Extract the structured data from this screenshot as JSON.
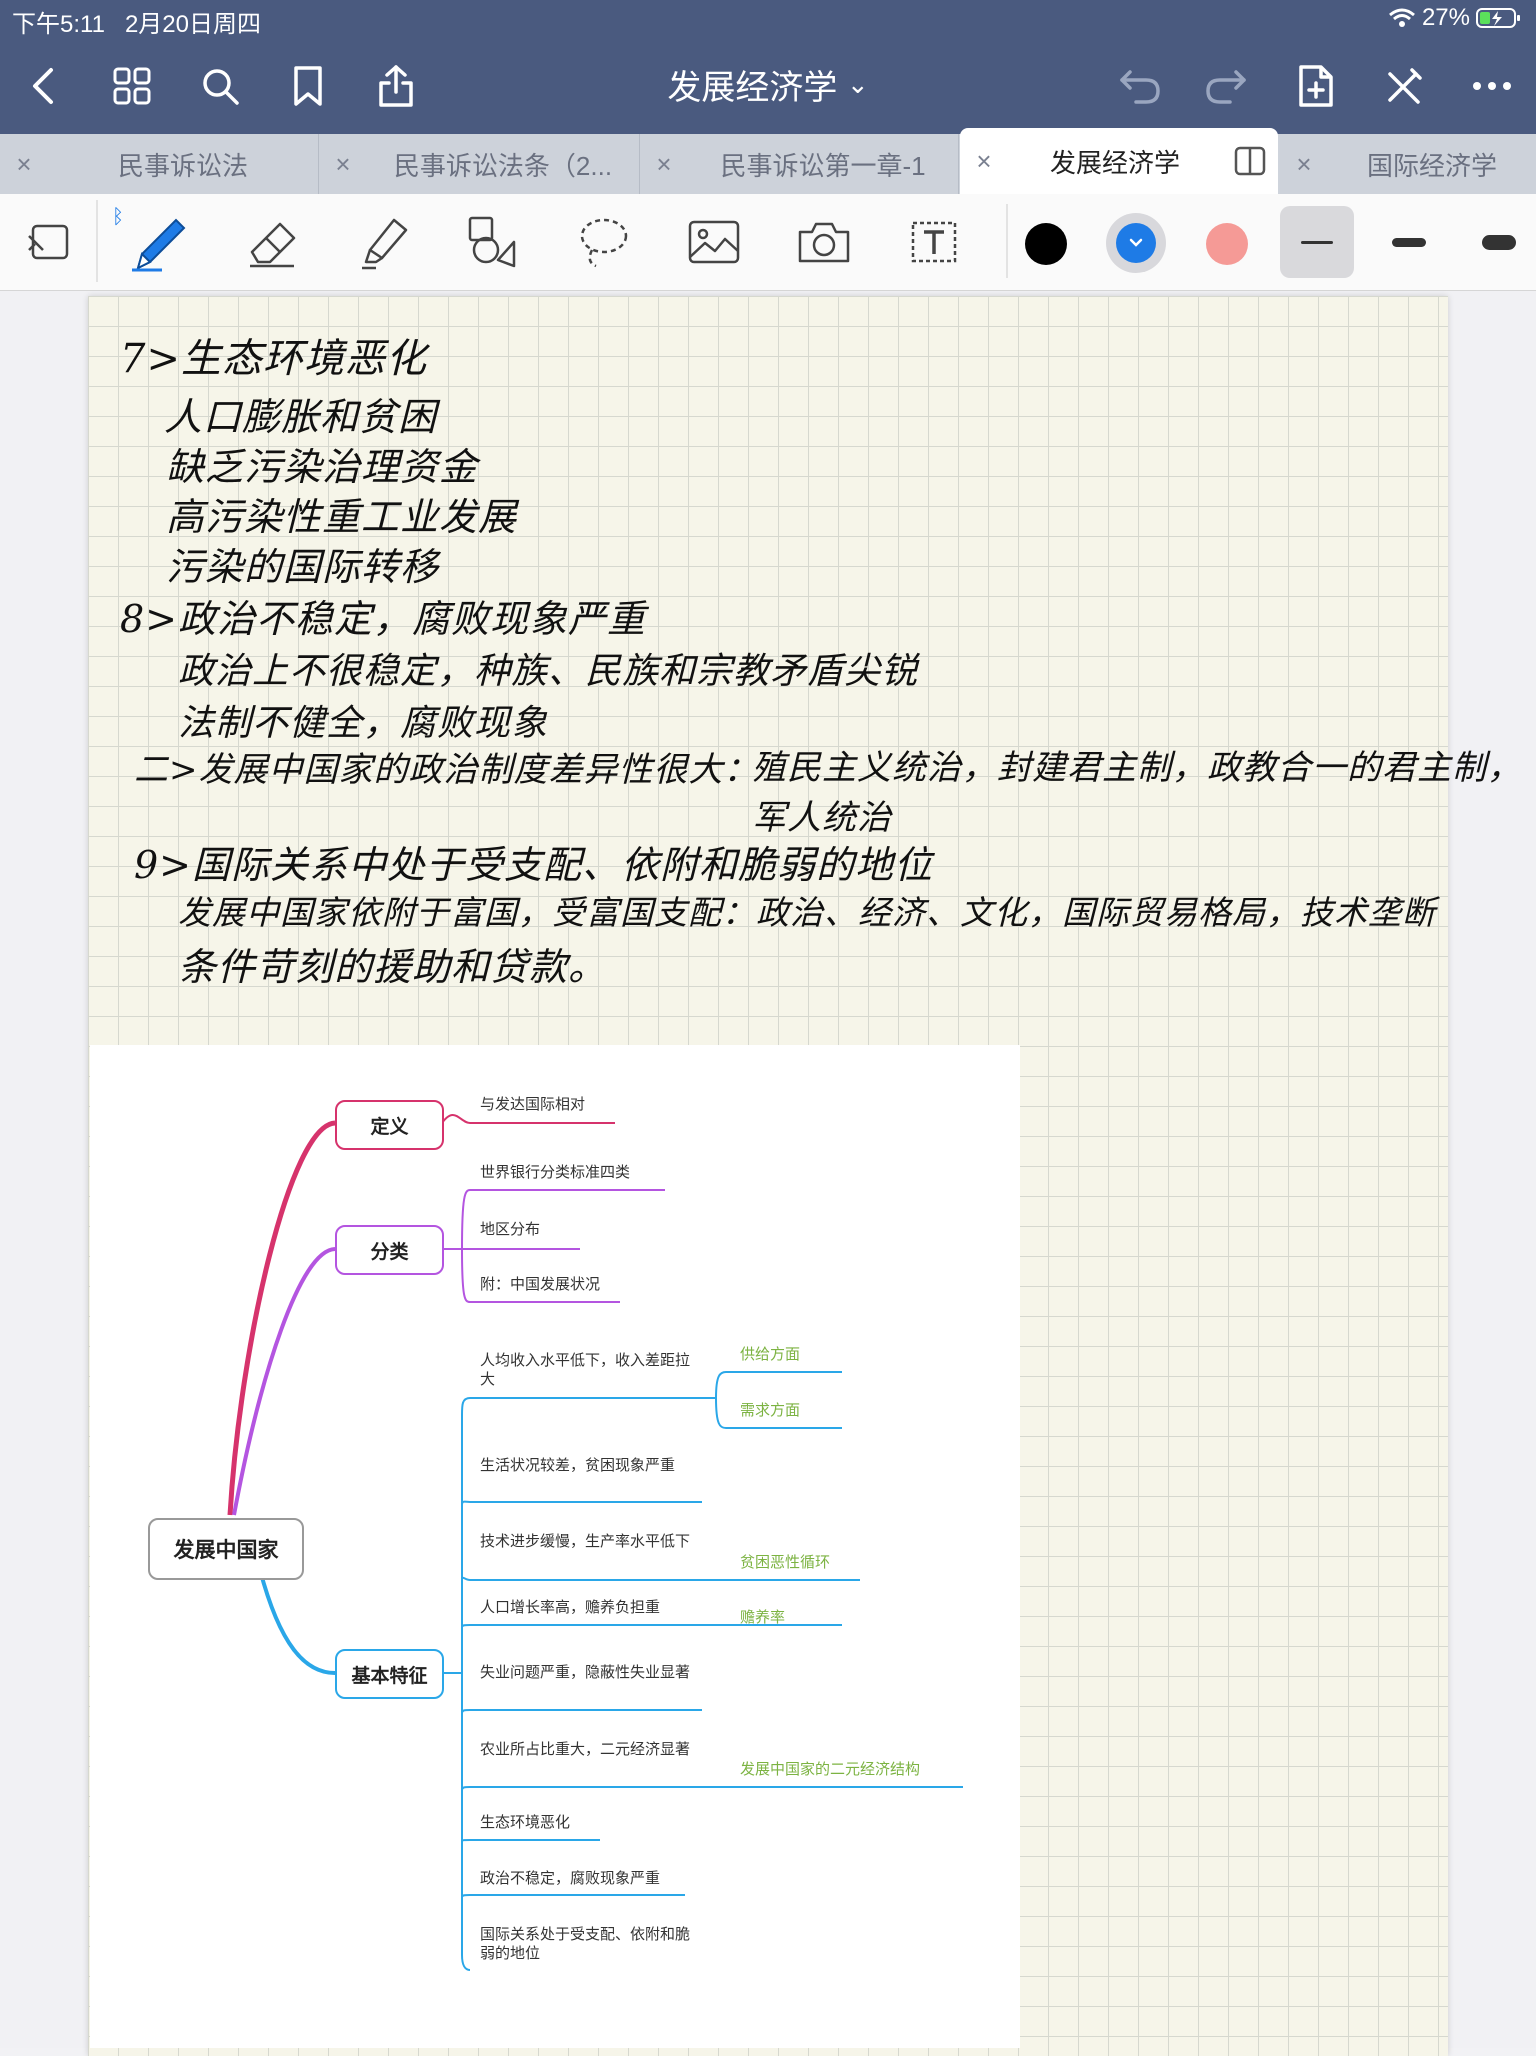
{
  "status_bar": {
    "time": "下午5:11",
    "date": "2月20日周四",
    "battery": "27%"
  },
  "nav": {
    "title": "发展经济学",
    "chevron": "⌄"
  },
  "tabs": [
    {
      "label": "民事诉讼法",
      "active": false
    },
    {
      "label": "民事诉讼法条（2...",
      "active": false
    },
    {
      "label": "民事诉讼第一章-1",
      "active": false
    },
    {
      "label": "发展经济学",
      "active": true
    },
    {
      "label": "国际经济学",
      "active": false
    }
  ],
  "toolbar": {
    "colors": [
      "#000000",
      "#1e7be6",
      "#f59a96"
    ],
    "selected_color": "#1e7be6",
    "stroke_widths": [
      "thin",
      "medium",
      "thick"
    ]
  },
  "handwriting": [
    "7>生态环境恶化",
    "人口膨胀和贫困",
    "缺乏污染治理资金",
    "高污染性重工业发展",
    "污染的国际转移",
    "8>政治不稳定，腐败现象严重",
    "政治上不很稳定，种族、民族和宗教矛盾尖锐",
    "法制不健全，腐败现象",
    "二>发展中国家的政治制度差异性很大：",
    "殖民主义统治，封建君主制，政教合一的君主制，",
    "军人统治",
    "9>国际关系中处于受支配、依附和脆弱的地位",
    "发展中国家依附于富国，受富国支配：政治、经济、文化，国际贸易格局，技术垄断",
    "条件苛刻的援助和贷款。"
  ],
  "mindmap": {
    "root": "发展中国家",
    "branches": [
      {
        "label": "定义",
        "color": "#d6336c",
        "leaves": [
          "与发达国际相对"
        ]
      },
      {
        "label": "分类",
        "color": "#b455e0",
        "leaves": [
          "世界银行分类标准四类",
          "地区分布",
          "附：中国发展状况"
        ]
      },
      {
        "label": "基本特征",
        "color": "#2aa7e8",
        "leaves": [
          "人均收入水平低下，收入差距拉大",
          "生活状况较差，贫困现象严重",
          "技术进步缓慢，生产率水平低下",
          "人口增长率高，赡养负担重",
          "失业问题严重，隐蔽性失业显著",
          "农业所占比重大，二元经济显著",
          "生态环境恶化",
          "政治不稳定，腐败现象严重",
          "国际关系处于受支配、依附和脆弱的地位"
        ]
      }
    ],
    "sub_labels": [
      "供给方面",
      "需求方面",
      "贫困恶性循环",
      "赡养率",
      "发展中国家的二元经济结构"
    ]
  }
}
